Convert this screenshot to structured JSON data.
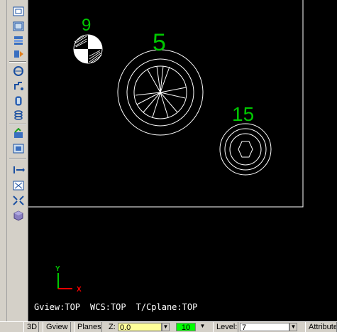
{
  "toolbar": {
    "icons": [
      "view-icon",
      "frame-icon",
      "layers-icon",
      "tools-icon",
      "arc-icon",
      "chain-icon",
      "cylinder-icon",
      "coil-icon",
      "edit-icon",
      "plane-icon",
      "transform-icon",
      "fit-icon",
      "zoom-icon",
      "solid-icon"
    ]
  },
  "canvas": {
    "labels": {
      "tool9": "9",
      "tool5": "5",
      "tool15": "15"
    },
    "axis": {
      "x": "X",
      "y": "Y"
    },
    "status": {
      "gview": "Gview:TOP",
      "wcs": "WCS:TOP",
      "cplane": "T/Cplane:TOP"
    },
    "colors": {
      "label": "#00c800",
      "geometry": "#ffffff",
      "axis_x": "#ff0000",
      "axis_y": "#00c800"
    }
  },
  "statusbar": {
    "btn_3d": "3D",
    "btn_gview": "Gview",
    "btn_planes": "Planes",
    "z_label": "Z:",
    "z_value": "0.0",
    "color_value": "10",
    "level_label": "Level:",
    "level_value": "7",
    "attributes": "Attribute",
    "colors": {
      "z_field": "#ffff99",
      "color_field": "#00ff00"
    }
  }
}
